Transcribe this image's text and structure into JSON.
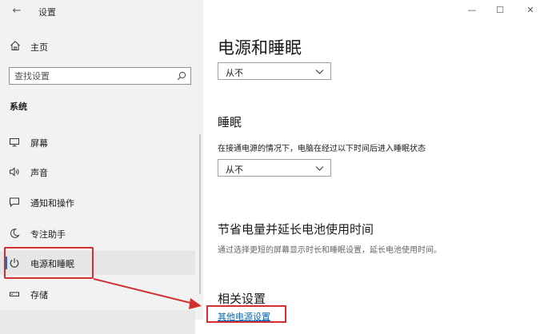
{
  "window": {
    "title": "设置",
    "back_glyph": "←",
    "minimize_glyph": "—",
    "maximize_glyph": "☐",
    "close_glyph": "✕"
  },
  "sidebar": {
    "home_label": "主页",
    "search_placeholder": "查找设置",
    "section_heading": "系统",
    "items": [
      {
        "label": "屏幕",
        "icon": "monitor-icon"
      },
      {
        "label": "声音",
        "icon": "speaker-icon"
      },
      {
        "label": "通知和操作",
        "icon": "notification-icon"
      },
      {
        "label": "专注助手",
        "icon": "moon-icon"
      },
      {
        "label": "电源和睡眠",
        "icon": "power-icon",
        "selected": true
      },
      {
        "label": "存储",
        "icon": "storage-icon"
      }
    ]
  },
  "main": {
    "page_title": "电源和睡眠",
    "screen_dropdown_value": "从不",
    "sleep_heading": "睡眠",
    "sleep_desc": "在接通电源的情况下，电脑在经过以下时间后进入睡眠状态",
    "sleep_dropdown_value": "从不",
    "save_heading": "节省电量并延长电池使用时间",
    "save_desc": "通过选择更短的屏幕显示时长和睡眠设置，延长电池使用时间。",
    "related_heading": "相关设置",
    "related_link": "其他电源设置"
  },
  "colors": {
    "accent": "#0078d7",
    "annotation_red": "#d42f2f",
    "link": "#0067b8"
  }
}
